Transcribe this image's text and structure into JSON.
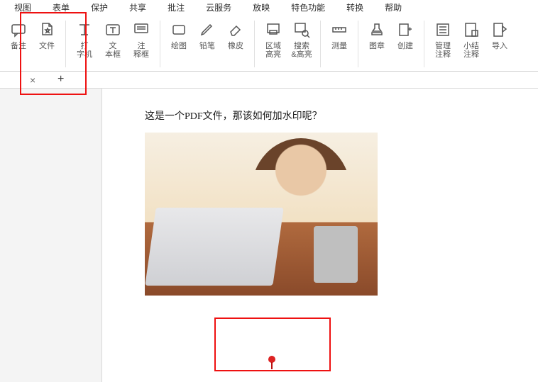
{
  "menu": [
    "视图",
    "表单",
    "保护",
    "共享",
    "批注",
    "云服务",
    "放映",
    "特色功能",
    "转换",
    "帮助"
  ],
  "toolbar": {
    "note": "备注",
    "file": "文件",
    "typewriter_a": "打",
    "typewriter_b": "字机",
    "textbox_a": "文",
    "textbox_b": "本框",
    "commentbox_a": "注",
    "commentbox_b": "释框",
    "draw": "绘图",
    "pencil": "铅笔",
    "eraser": "橡皮",
    "areahl_a": "区域",
    "areahl_b": "高亮",
    "searchhl_a": "搜索",
    "searchhl_b": "&高亮",
    "measure": "测量",
    "stamp": "图章",
    "create": "创建",
    "mgmt_a": "管理",
    "mgmt_b": "注释",
    "summary_a": "小结",
    "summary_b": "注释",
    "import": "导入"
  },
  "document": {
    "body_text": "这是一个PDF文件，那该如何加水印呢？"
  }
}
